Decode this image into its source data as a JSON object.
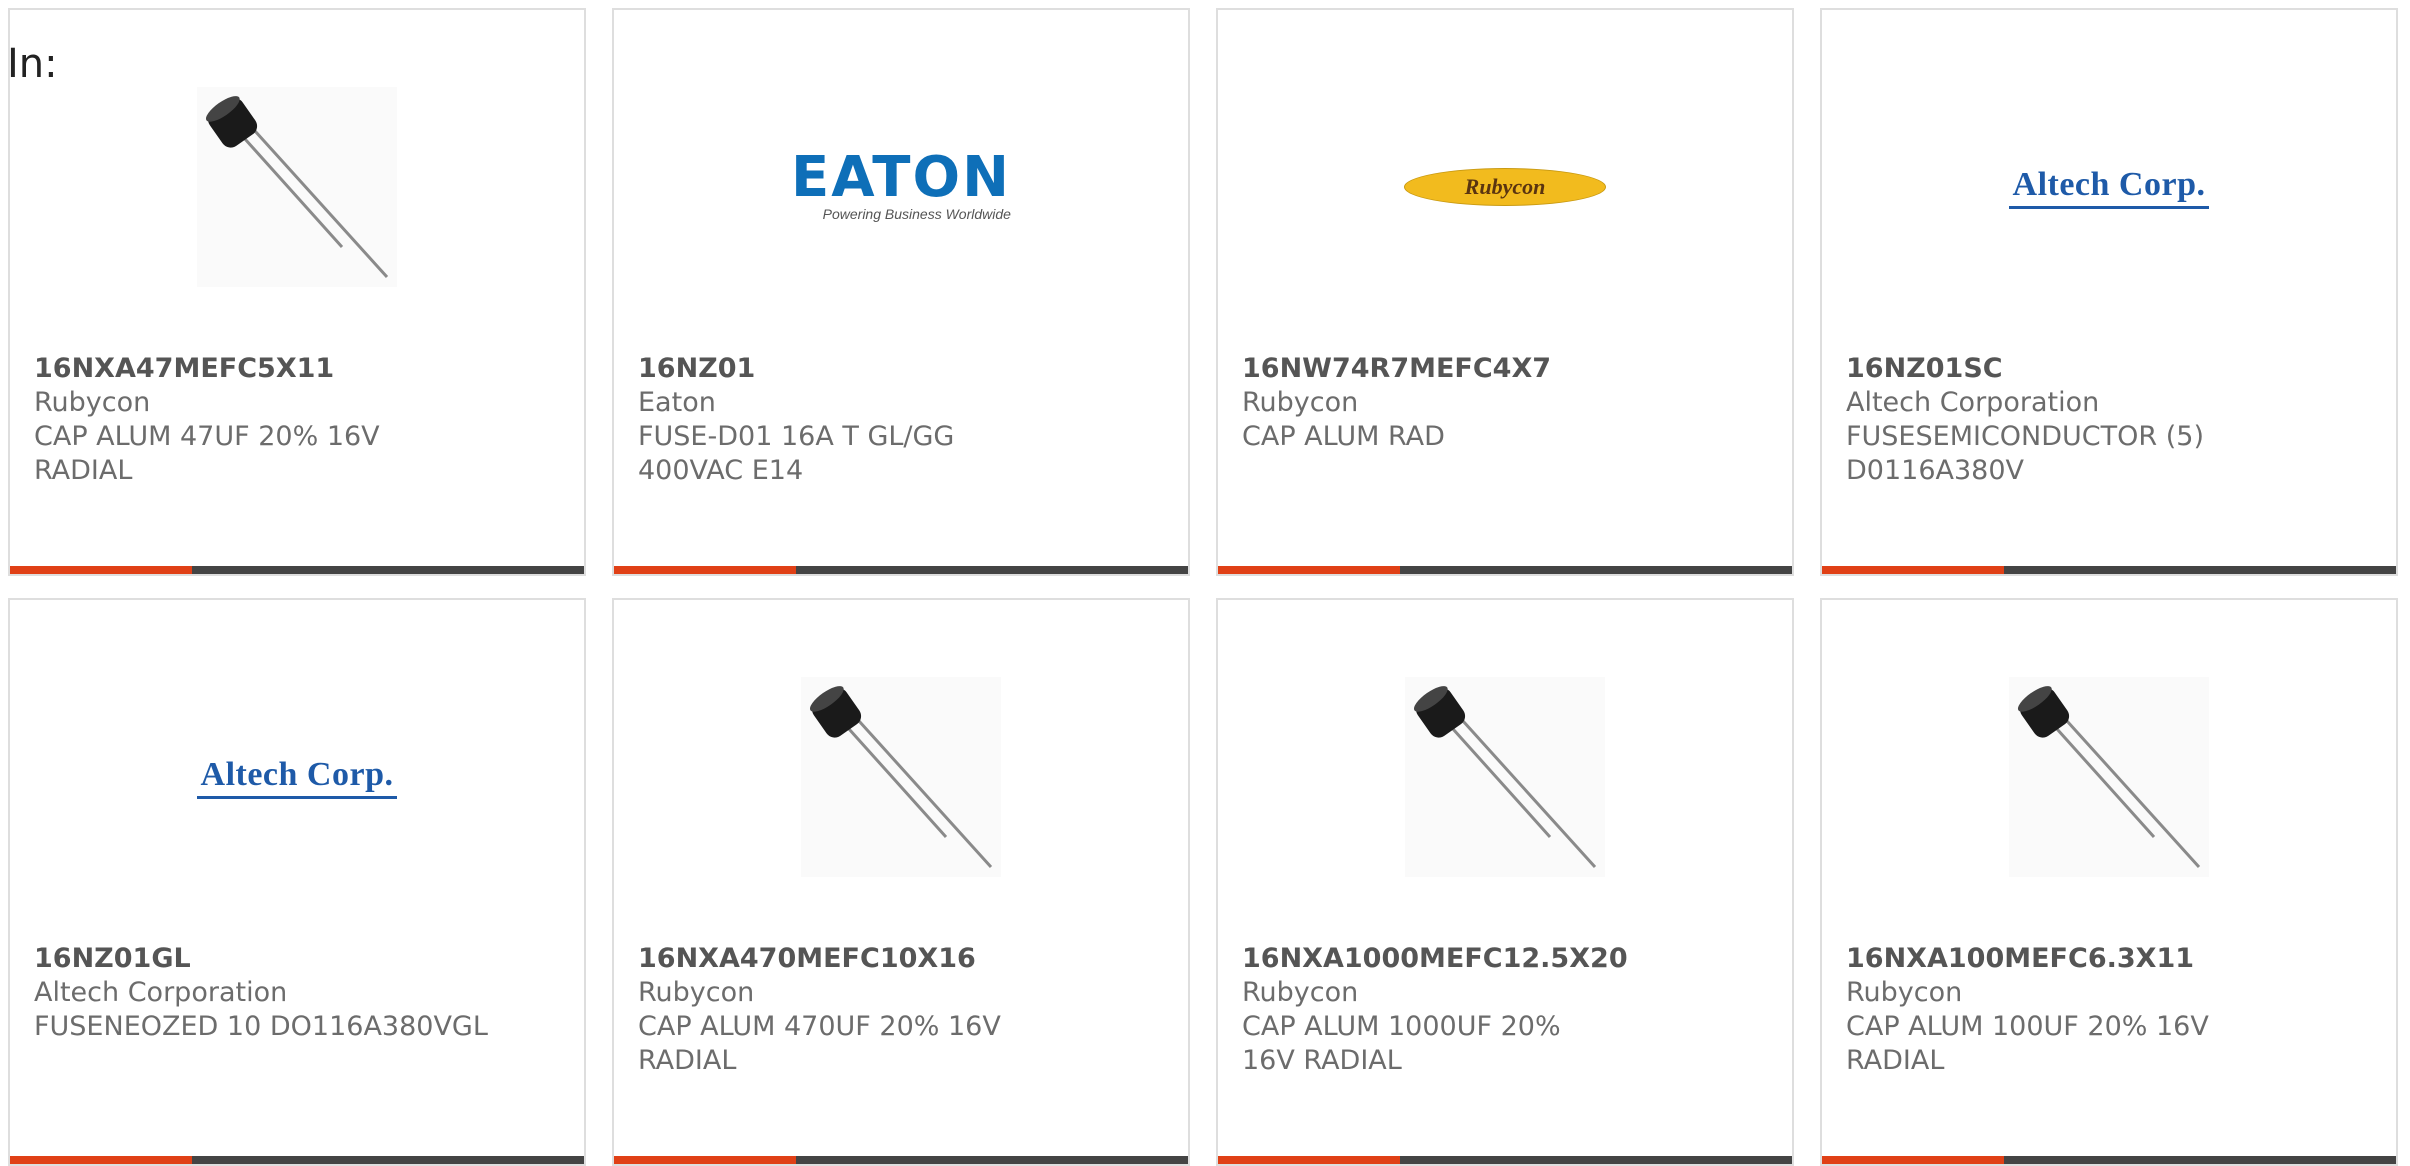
{
  "filter_label": "In:",
  "products": [
    {
      "part_number": "16NXA47MEFC5X11",
      "manufacturer": "Rubycon",
      "description": "CAP ALUM 47UF 20% 16V RADIAL",
      "image": "capacitor-photo"
    },
    {
      "part_number": "16NZ01",
      "manufacturer": "Eaton",
      "description": "FUSE-D01 16A T GL/GG 400VAC E14",
      "image": "eaton-logo",
      "logo_text": "EATON",
      "logo_tagline": "Powering Business Worldwide"
    },
    {
      "part_number": "16NW74R7MEFC4X7",
      "manufacturer": "Rubycon",
      "description": "CAP ALUM RAD",
      "image": "rubycon-logo",
      "logo_text": "Rubycon"
    },
    {
      "part_number": "16NZ01SC",
      "manufacturer": "Altech Corporation",
      "description": "FUSESEMICONDUCTOR (5) D0116A380V",
      "image": "altech-logo",
      "logo_text": "Altech Corp."
    },
    {
      "part_number": "16NZ01GL",
      "manufacturer": "Altech Corporation",
      "description": "FUSENEOZED 10 DO116A380VGL",
      "image": "altech-logo",
      "logo_text": "Altech Corp."
    },
    {
      "part_number": "16NXA470MEFC10X16",
      "manufacturer": "Rubycon",
      "description": "CAP ALUM 470UF 20% 16V RADIAL",
      "image": "capacitor-photo"
    },
    {
      "part_number": "16NXA1000MEFC12.5X20",
      "manufacturer": "Rubycon",
      "description": "CAP ALUM 1000UF 20% 16V RADIAL",
      "image": "capacitor-photo"
    },
    {
      "part_number": "16NXA100MEFC6.3X11",
      "manufacturer": "Rubycon",
      "description": "CAP ALUM 100UF 20% 16V RADIAL",
      "image": "capacitor-photo"
    }
  ],
  "colors": {
    "accent": "#e04016",
    "bar": "#444444",
    "border": "#dedede",
    "eaton_blue": "#0e6fb8",
    "altech_blue": "#1e5aa8",
    "rubycon_yellow": "#f2bb1e"
  }
}
